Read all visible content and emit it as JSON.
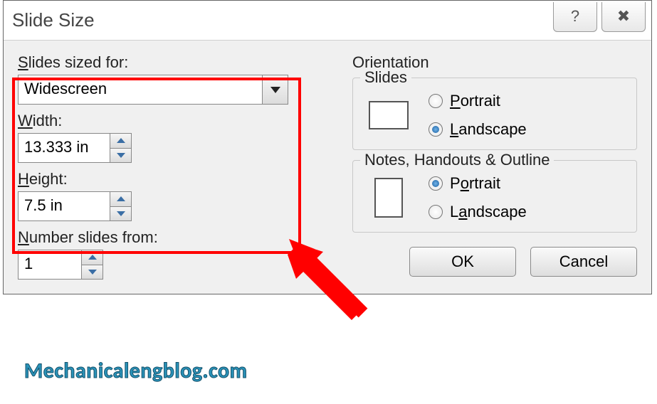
{
  "dialog": {
    "title": "Slide Size",
    "help_symbol": "?",
    "close_symbol": "✕"
  },
  "left": {
    "sized_for_label": "Slides sized for:",
    "sized_for_value": "Widescreen",
    "width_label": "Width:",
    "width_value": "13.333 in",
    "height_label": "Height:",
    "height_value": "7.5 in",
    "number_from_label": "Number slides from:",
    "number_from_value": "1"
  },
  "orientation": {
    "group_label": "Orientation",
    "slides": {
      "label": "Slides",
      "portrait": "Portrait",
      "landscape": "Landscape",
      "selected": "landscape"
    },
    "notes": {
      "label": "Notes, Handouts & Outline",
      "portrait": "Portrait",
      "landscape": "Landscape",
      "selected": "portrait"
    }
  },
  "buttons": {
    "ok": "OK",
    "cancel": "Cancel"
  },
  "watermark": "Mechanicalengblog.com"
}
